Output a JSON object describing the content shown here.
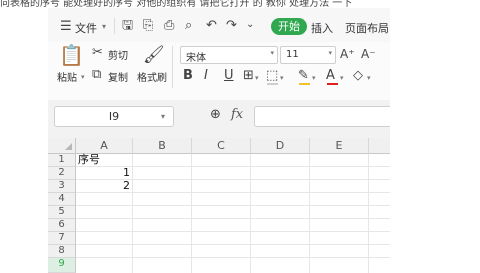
{
  "top_text": "向表格的序号 能处理好的序号 对他的组织有 请把它打开 的 教你 处理方法 一下",
  "menubar": {
    "file_label": "文件",
    "tabs": [
      {
        "label": "开始",
        "active": true
      },
      {
        "label": "插入",
        "active": false
      },
      {
        "label": "页面布局",
        "active": false
      }
    ]
  },
  "ribbon": {
    "paste_label": "粘贴",
    "cut_label": "剪切",
    "copy_label": "复制",
    "format_painter_label": "格式刷",
    "font_name": "宋体",
    "font_size": "11",
    "grow_font": "A⁺",
    "shrink_font": "A⁻",
    "bold": "B",
    "italic": "I",
    "underline": "U"
  },
  "formula_bar": {
    "name_box": "I9",
    "fx": "fx",
    "formula": ""
  },
  "sheet": {
    "columns": [
      "A",
      "B",
      "C",
      "D",
      "E"
    ],
    "rows": [
      "1",
      "2",
      "3",
      "4",
      "5",
      "6",
      "7",
      "8",
      "9"
    ],
    "cells": {
      "A1": "序号",
      "A2": "1",
      "A3": "2"
    }
  },
  "colors": {
    "accent": "#2fa84f",
    "font_color_bar": "#e02020",
    "highlight_bar": "#f2c12e"
  }
}
